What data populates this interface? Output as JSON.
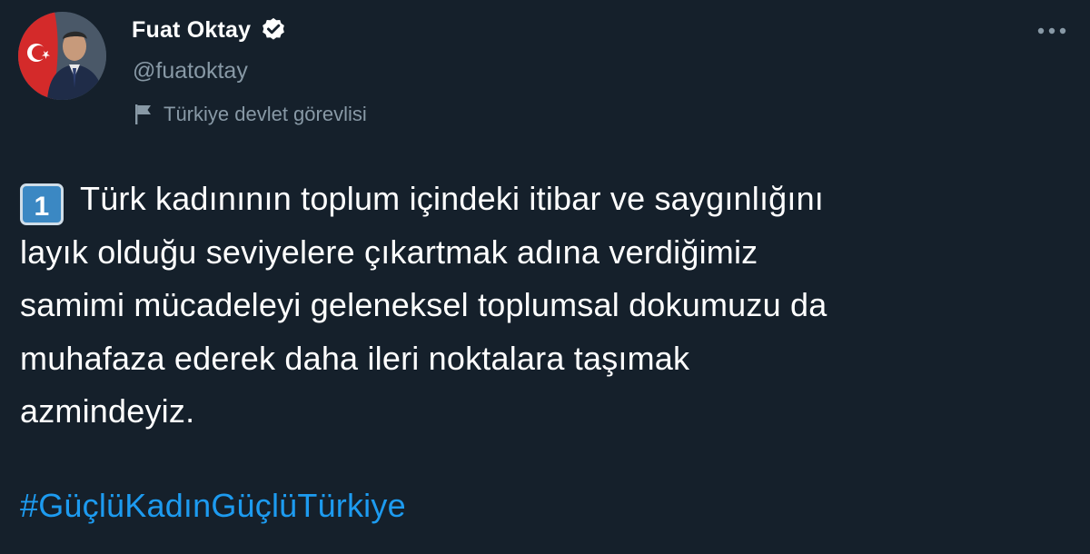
{
  "author": {
    "display_name": "Fuat Oktay",
    "handle": "@fuatoktay",
    "verified": true,
    "label": "Türkiye devlet görevlisi"
  },
  "icons": {
    "verified": "verified-badge-icon",
    "label": "flag-icon",
    "more": "more-horizontal-icon",
    "avatar": "profile-photo"
  },
  "tweet": {
    "keycap": "1",
    "lines": [
      "Türk kadınının toplum içindeki itibar ve saygınlığını",
      "layık olduğu seviyelere çıkartmak adına verdiğimiz",
      "samimi mücadeleyi geleneksel toplumsal dokumuzu da",
      "muhafaza ederek daha ileri noktalara taşımak",
      "azmindeyiz."
    ],
    "hashtag": "#GüçlüKadınGüçlüTürkiye"
  },
  "colors": {
    "background": "#15202b",
    "text": "#ffffff",
    "secondary_text": "#8899a6",
    "link": "#1d9bf0",
    "keycap": "#3b88c3"
  }
}
